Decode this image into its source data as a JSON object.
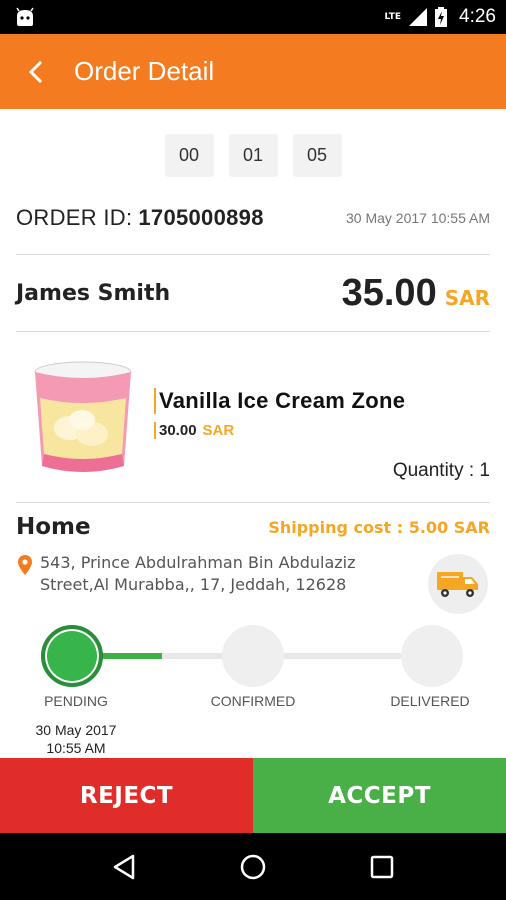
{
  "status_bar": {
    "network": "LTE",
    "time": "4:26"
  },
  "app_bar": {
    "title": "Order Detail"
  },
  "timer": [
    "00",
    "01",
    "05"
  ],
  "order": {
    "id_label": "ORDER ID:",
    "id": "1705000898",
    "date": "30 May 2017 10:55 AM"
  },
  "customer": {
    "name": "James Smith",
    "total": "35.00",
    "currency": "SAR"
  },
  "product": {
    "name": "Vanilla Ice Cream Zone",
    "price": "30.00",
    "currency": "SAR",
    "quantity": "Quantity : 1"
  },
  "address": {
    "label": "Home",
    "shipping": "Shipping cost : 5.00 SAR",
    "line1": "543, Prince Abdulrahman Bin Abdulaziz",
    "line2": "Street,Al Murabba,, 17, Jeddah, 12628"
  },
  "progress": {
    "steps": [
      {
        "label": "PENDING",
        "state": "active"
      },
      {
        "label": "CONFIRMED",
        "state": "inactive"
      },
      {
        "label": "DELIVERED",
        "state": "inactive"
      }
    ],
    "pending_date_line1": "30 May 2017",
    "pending_date_line2": "10:55 AM"
  },
  "actions": {
    "reject": "REJECT",
    "accept": "ACCEPT"
  },
  "colors": {
    "primary": "#f47b20",
    "accent": "#f5a623",
    "reject": "#e12d2a",
    "accept": "#48b046",
    "progress": "#38b54a"
  }
}
